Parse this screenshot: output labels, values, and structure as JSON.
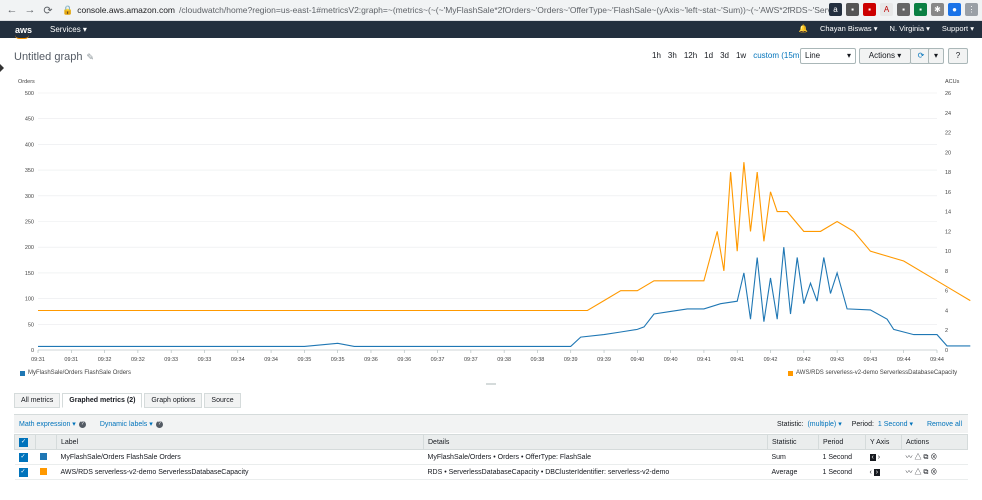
{
  "browser": {
    "url_host": "console.aws.amazon.com",
    "url_path": "/cloudwatch/home?region=us-east-1#metricsV2:graph=~(metrics~(~(~'MyFlashSale*2fOrders~'Orders~'OfferType~'FlashSale~(yAxis~'left~stat~'Sum))~(~'AWS*2fRDS~'ServerlessDatabaseCapacity~'DBClu..."
  },
  "aws_nav": {
    "logo": "aws",
    "services": "Services",
    "user": "Chayan Biswas",
    "region": "N. Virginia",
    "support": "Support"
  },
  "graph": {
    "title": "Untitled graph",
    "time_ranges": [
      "1h",
      "3h",
      "12h",
      "1d",
      "3d",
      "1w"
    ],
    "custom_range": "custom (15m)",
    "chart_type_select": "Line",
    "actions_label": "Actions",
    "help": "?"
  },
  "chart_data": {
    "type": "line",
    "y_left_label": "Orders",
    "y_right_label": "ACUs",
    "y_left_ticks": [
      0,
      50,
      100,
      150,
      200,
      250,
      300,
      350,
      400,
      450,
      500
    ],
    "y_right_ticks": [
      0,
      2,
      4,
      6,
      8,
      10,
      12,
      14,
      16,
      18,
      20,
      22,
      24,
      26
    ],
    "x_ticks": [
      "09:31",
      "09:31",
      "09:32",
      "09:32",
      "09:33",
      "09:33",
      "09:34",
      "09:34",
      "09:35",
      "09:35",
      "09:36",
      "09:36",
      "09:37",
      "09:37",
      "09:38",
      "09:38",
      "09:39",
      "09:39",
      "09:40",
      "09:40",
      "09:41",
      "09:41",
      "09:42",
      "09:42",
      "09:43",
      "09:43",
      "09:44",
      "09:44"
    ],
    "series": [
      {
        "name": "MyFlashSale/Orders FlashSale Orders",
        "color": "#1f77b4",
        "axis": "left",
        "points": [
          [
            0,
            7
          ],
          [
            8,
            7
          ],
          [
            9,
            13
          ],
          [
            9.5,
            7
          ],
          [
            15,
            7
          ],
          [
            16,
            7
          ],
          [
            16.3,
            25
          ],
          [
            17,
            30
          ],
          [
            17.5,
            35
          ],
          [
            18,
            40
          ],
          [
            18.2,
            45
          ],
          [
            18.5,
            70
          ],
          [
            19,
            75
          ],
          [
            19.5,
            80
          ],
          [
            20,
            80
          ],
          [
            20.5,
            90
          ],
          [
            21,
            95
          ],
          [
            21.2,
            150
          ],
          [
            21.4,
            60
          ],
          [
            21.6,
            180
          ],
          [
            21.8,
            55
          ],
          [
            22,
            140
          ],
          [
            22.2,
            60
          ],
          [
            22.4,
            200
          ],
          [
            22.6,
            70
          ],
          [
            22.8,
            180
          ],
          [
            23,
            90
          ],
          [
            23.2,
            130
          ],
          [
            23.4,
            95
          ],
          [
            23.6,
            180
          ],
          [
            23.8,
            110
          ],
          [
            24,
            150
          ],
          [
            24.3,
            80
          ],
          [
            25,
            78
          ],
          [
            25.5,
            60
          ],
          [
            25.7,
            40
          ],
          [
            26.3,
            30
          ],
          [
            27,
            30
          ],
          [
            27.3,
            8
          ],
          [
            28,
            8
          ]
        ]
      },
      {
        "name": "AWS/RDS serverless-v2-demo ServerlessDatabaseCapacity",
        "color": "#ff9900",
        "axis": "right",
        "points": [
          [
            0,
            4
          ],
          [
            15.5,
            4
          ],
          [
            16.5,
            4
          ],
          [
            17,
            5
          ],
          [
            17.5,
            6
          ],
          [
            18,
            6
          ],
          [
            18.5,
            7
          ],
          [
            19,
            7
          ],
          [
            20,
            7
          ],
          [
            20.4,
            12
          ],
          [
            20.6,
            8
          ],
          [
            20.8,
            18
          ],
          [
            21,
            10
          ],
          [
            21.2,
            19
          ],
          [
            21.4,
            12
          ],
          [
            21.6,
            18
          ],
          [
            21.8,
            11
          ],
          [
            22,
            16
          ],
          [
            22.2,
            14
          ],
          [
            22.5,
            14
          ],
          [
            23,
            12
          ],
          [
            23.5,
            12
          ],
          [
            24,
            13
          ],
          [
            24.5,
            12
          ],
          [
            25,
            10
          ],
          [
            26,
            9
          ],
          [
            27,
            7
          ],
          [
            27.5,
            6
          ],
          [
            28,
            5
          ]
        ]
      }
    ],
    "legend": [
      {
        "label": "MyFlashSale/Orders FlashSale Orders",
        "color": "#1f77b4"
      },
      {
        "label": "AWS/RDS serverless-v2-demo ServerlessDatabaseCapacity",
        "color": "#ff9900"
      }
    ]
  },
  "tabs": [
    {
      "label": "All metrics"
    },
    {
      "label": "Graphed metrics (2)"
    },
    {
      "label": "Graph options"
    },
    {
      "label": "Source"
    }
  ],
  "toolbar": {
    "math_expression": "Math expression",
    "dynamic_labels": "Dynamic labels",
    "statistic_label": "Statistic:",
    "statistic_value": "(multiple)",
    "period_label": "Period:",
    "period_value": "1 Second",
    "remove_all": "Remove all"
  },
  "table": {
    "headers": {
      "label": "Label",
      "details": "Details",
      "statistic": "Statistic",
      "period": "Period",
      "y_axis": "Y Axis",
      "actions": "Actions"
    },
    "rows": [
      {
        "color": "#1f77b4",
        "label": "MyFlashSale/Orders FlashSale Orders",
        "details": "MyFlashSale/Orders • Orders • OfferType: FlashSale",
        "statistic": "Sum",
        "period": "1 Second"
      },
      {
        "color": "#ff9900",
        "label": "AWS/RDS serverless-v2-demo ServerlessDatabaseCapacity",
        "details": "RDS • ServerlessDatabaseCapacity • DBClusterIdentifier: serverless-v2-demo",
        "statistic": "Average",
        "period": "1 Second"
      }
    ]
  }
}
